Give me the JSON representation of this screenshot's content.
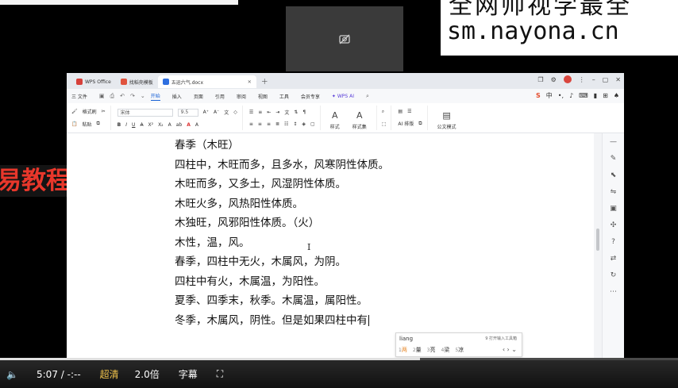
{
  "watermark": {
    "line1": "全网帅视学最全",
    "line2": "sm.nayona.cn"
  },
  "banner": {
    "text": "易教程"
  },
  "tabs": [
    {
      "label": "WPS Office",
      "color": "#d6403a"
    },
    {
      "label": "找稻壳模板",
      "color": "#e0533e"
    },
    {
      "label": "五运六气.docx",
      "color": "#2f6fe0",
      "active": true
    }
  ],
  "menu": {
    "file": "三 文件",
    "items": [
      "开始",
      "插入",
      "页面",
      "引用",
      "审阅",
      "视图",
      "工具",
      "会员专享"
    ],
    "active": "开始",
    "wps_ai": "WPS AI"
  },
  "ribbon": {
    "format_painter": "格式刷",
    "paste": "粘贴",
    "font_name": "宋体",
    "font_size": "9.5",
    "styles": "样式",
    "style_set": "样式集",
    "find": "查找",
    "ai_layout": "AI 排版",
    "official_doc": "公文模式"
  },
  "document": {
    "lines": [
      "春季（木旺）",
      "四柱中，木旺而多，且多水，风寒阴性体质。",
      "木旺而多，又多土，风湿阴性体质。",
      "木旺火多，风热阳性体质。",
      "木独旺，风邪阳性体质。（火）",
      "木性，温，风。",
      "春季，四柱中无火，木属风，为阴。",
      "四柱中有火，木属温，为阳性。",
      "夏季、四季末，秋季。木属温，属阳性。",
      "冬季，木属风，阴性。但是如果四柱中有"
    ]
  },
  "ime": {
    "pinyin": "liang",
    "hint": "9 打开输入工具箱",
    "candidates": [
      {
        "n": "1",
        "t": "两"
      },
      {
        "n": "2",
        "t": "量"
      },
      {
        "n": "3",
        "t": "亮"
      },
      {
        "n": "4",
        "t": "梁"
      },
      {
        "n": "5",
        "t": "凉"
      }
    ]
  },
  "player": {
    "time": "5:07 / -:--",
    "quality": "超清",
    "speed": "2.0倍",
    "subtitles": "字幕",
    "progress": 0.62
  }
}
